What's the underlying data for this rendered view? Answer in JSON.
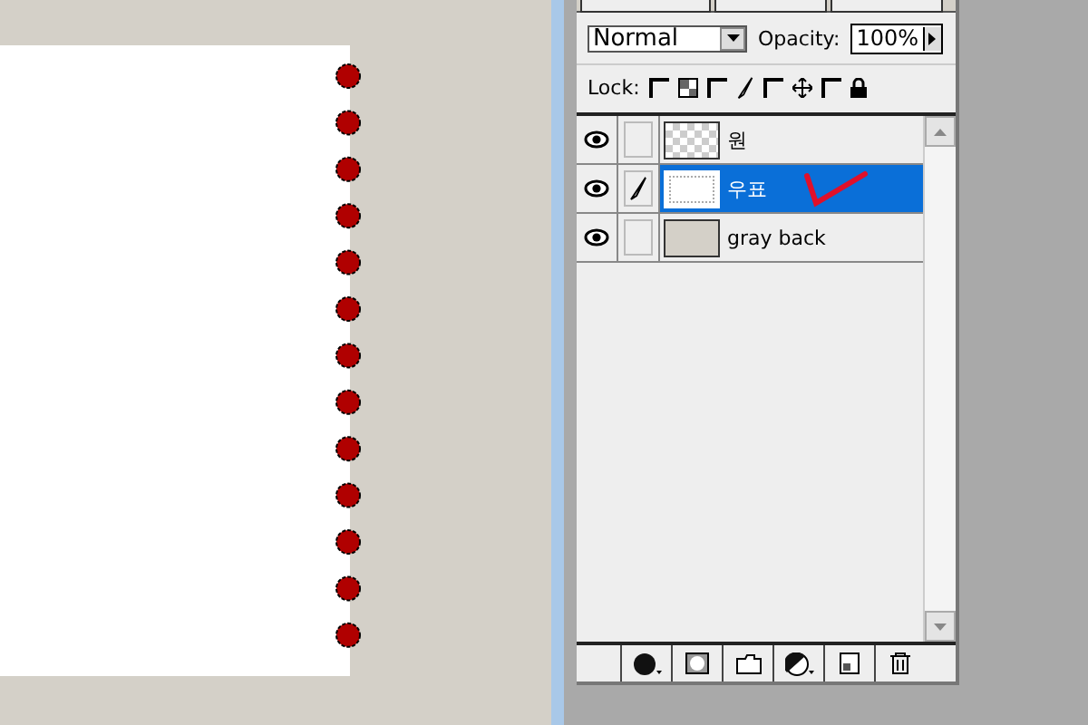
{
  "options": {
    "blend_mode": "Normal",
    "opacity_label": "Opacity:",
    "opacity": "100%"
  },
  "lock": {
    "label": "Lock:",
    "options": [
      {
        "kind": "transparency",
        "checked": false
      },
      {
        "kind": "paint",
        "checked": false
      },
      {
        "kind": "move",
        "checked": false
      },
      {
        "kind": "all",
        "checked": false
      }
    ]
  },
  "layers": [
    {
      "name": "원",
      "selected": false,
      "visible": true,
      "brush": false,
      "kind": "transparent"
    },
    {
      "name": "우표",
      "selected": true,
      "visible": true,
      "brush": true,
      "kind": "stamp"
    },
    {
      "name": "gray back",
      "selected": false,
      "visible": true,
      "brush": false,
      "kind": "gray"
    }
  ]
}
